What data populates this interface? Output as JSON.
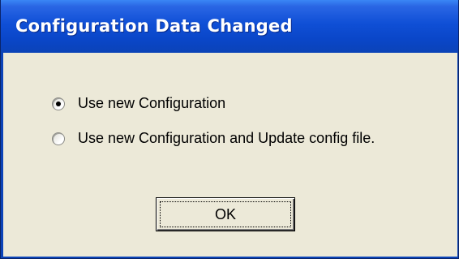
{
  "window": {
    "title": "Configuration Data Changed"
  },
  "options": [
    {
      "label": "Use new Configuration",
      "selected": true
    },
    {
      "label": "Use new Configuration and Update config file.",
      "selected": false
    }
  ],
  "buttons": {
    "ok_label": "OK"
  },
  "colors": {
    "titlebar": "#0a46c8",
    "client": "#ece9d8",
    "title_text": "#ffffff"
  }
}
